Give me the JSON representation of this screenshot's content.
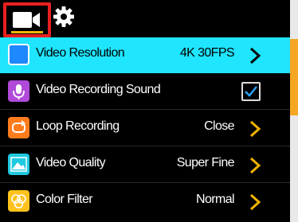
{
  "tabs": [
    {
      "name": "video",
      "active": true,
      "icon": "video-camera-icon"
    },
    {
      "name": "settings",
      "active": false,
      "icon": "gear-icon"
    }
  ],
  "menu": {
    "items": [
      {
        "label": "Video Resolution",
        "value": "4K 30FPS",
        "control": "chevron",
        "selected": true,
        "icon": "video-resolution-icon"
      },
      {
        "label": "Video Recording Sound",
        "value": "",
        "control": "checkbox",
        "checked": true,
        "icon": "microphone-icon"
      },
      {
        "label": "Loop Recording",
        "value": "Close",
        "control": "chevron",
        "icon": "loop-icon"
      },
      {
        "label": "Video Quality",
        "value": "Super Fine",
        "control": "chevron",
        "icon": "landscape-image-icon"
      },
      {
        "label": "Color Filter",
        "value": "Normal",
        "control": "chevron",
        "icon": "color-filter-icon"
      }
    ]
  },
  "colors": {
    "selected_row": "#1fe5ff",
    "accent": "#f0b400",
    "active_tab_border": "#e8201f",
    "scroll_thumb": "#f5a623"
  }
}
